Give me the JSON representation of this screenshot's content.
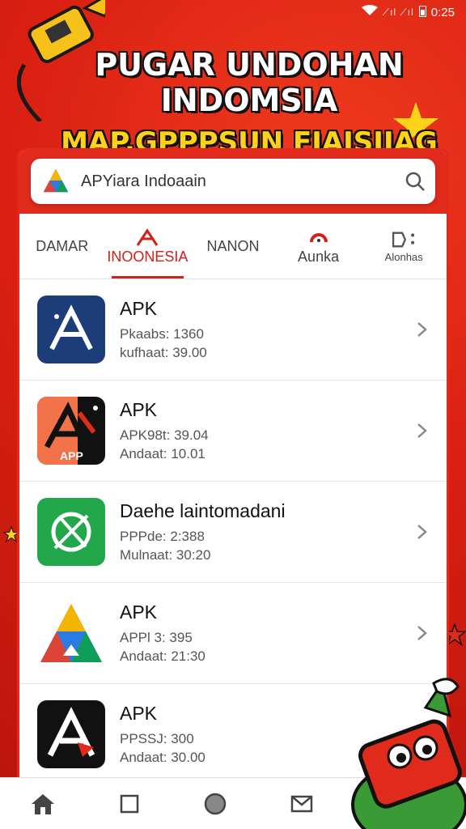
{
  "status": {
    "time": "0:25",
    "signal": "⟋ıl ⟋ıl"
  },
  "banner": {
    "title": "PUGAR UNDOHAN INDOMSIA",
    "subtitle": "MAP.GPPPSUN FIAISIIAG"
  },
  "search": {
    "value": "APYiara Indoaain"
  },
  "tabs": [
    {
      "label": "DAMAR"
    },
    {
      "label": "INOONESIA"
    },
    {
      "label": "NANON"
    },
    {
      "label": "Aunka"
    },
    {
      "label": "Alonhas"
    }
  ],
  "apps": [
    {
      "name": "APK",
      "line1": "Pkaabs: 1360",
      "line2": "kufhaat: 39.00"
    },
    {
      "name": "APK",
      "line1": "APK98t: 39.04",
      "line2": "Andaat: 10.01"
    },
    {
      "name": "Daehe laintomadani",
      "line1": "PPPde: 2:388",
      "line2": "Mulnaat: 30:20"
    },
    {
      "name": "APK",
      "line1": "APPl 3: 395",
      "line2": "Andaat: 21:30"
    },
    {
      "name": "APK",
      "line1": "PPSSJ: 300",
      "line2": "Andaat: 30.00"
    }
  ],
  "app2_badge": "APP",
  "colors": {
    "brand_red": "#d81f12",
    "accent_yellow": "#ffd21a"
  },
  "icons": [
    "home-icon",
    "square-icon",
    "circle-icon",
    "mail-icon",
    "search-icon",
    "chevron-right-icon"
  ]
}
